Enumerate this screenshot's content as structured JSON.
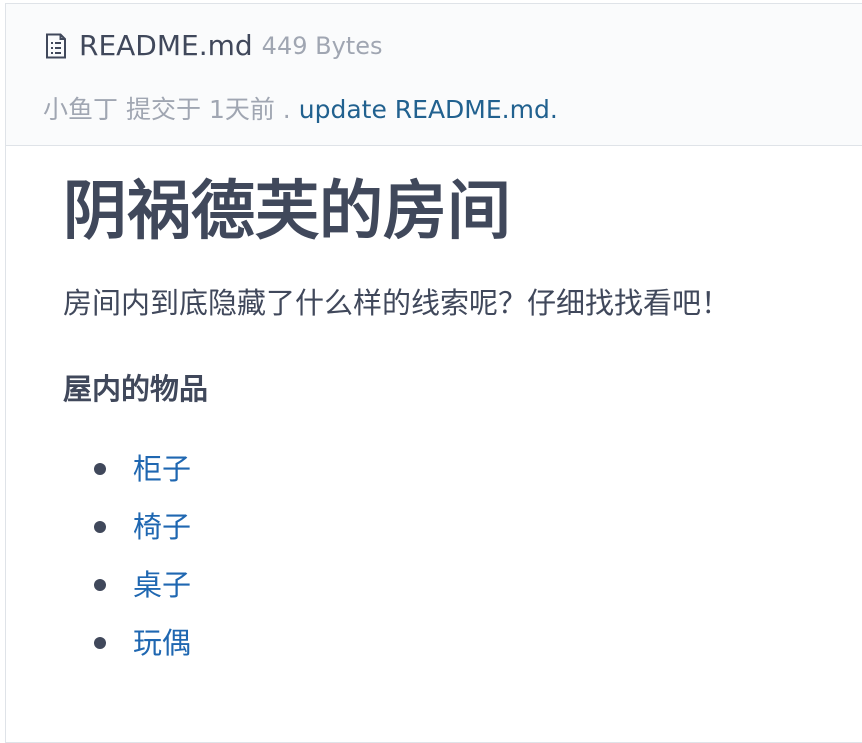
{
  "file": {
    "name": "README.md",
    "size": "449 Bytes",
    "icon": "file-text-icon"
  },
  "commit": {
    "author": "小鱼丁",
    "action": "提交于",
    "time": "1天前",
    "separator": ".",
    "message": "update README.md."
  },
  "readme": {
    "title": "阴祸德芙的房间",
    "lead": "房间内到底隐藏了什么样的线索呢？仔细找找看吧！",
    "section_title": "屋内的物品",
    "items": [
      {
        "label": "柜子"
      },
      {
        "label": "椅子"
      },
      {
        "label": "桌子"
      },
      {
        "label": "玩偶"
      }
    ]
  },
  "colors": {
    "text": "#40485b",
    "muted": "#a0a6b2",
    "link": "#1f67b1",
    "commit_link": "#21618f",
    "header_bg": "#fafbfc",
    "border": "#dfe3e8"
  }
}
